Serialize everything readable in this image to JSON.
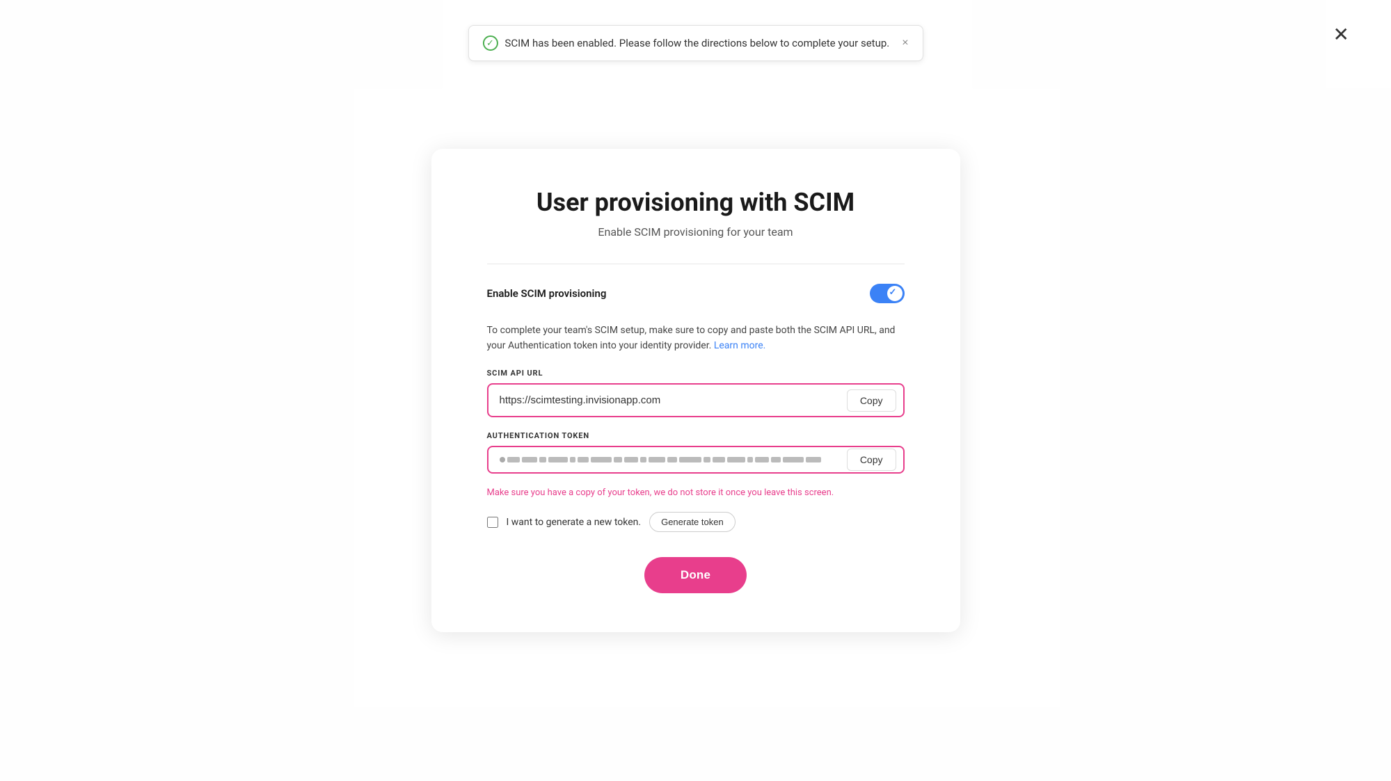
{
  "modal": {
    "title": "User provisioning with SCIM",
    "subtitle": "Enable SCIM provisioning for your team",
    "close_label": "✕",
    "divider": true,
    "toggle": {
      "label": "Enable SCIM provisioning",
      "enabled": true
    },
    "description": {
      "text": "To complete your team's SCIM setup, make sure to copy and paste both the SCIM API URL, and your Authentication token into your identity provider.",
      "link_text": "Learn more.",
      "link_url": "#"
    },
    "scim_api_url": {
      "label": "SCIM API URL",
      "value": "https://scimtesting.invisionapp.com",
      "copy_label": "Copy"
    },
    "auth_token": {
      "label": "Authentication token",
      "copy_label": "Copy"
    },
    "warning": "Make sure you have a copy of your token, we do not store it once you leave this screen.",
    "generate_row": {
      "checkbox_label": "I want to generate a new token.",
      "btn_label": "Generate token"
    },
    "done_label": "Done"
  },
  "toast": {
    "message": "SCIM has been enabled. Please follow the directions below to complete your setup.",
    "close_label": "×"
  },
  "icons": {
    "check_circle": "✓",
    "close_x": "✕"
  }
}
